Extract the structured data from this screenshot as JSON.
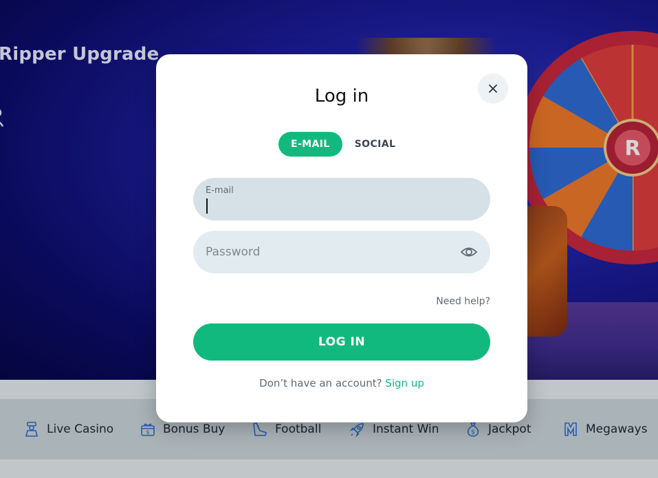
{
  "background": {
    "promo_title": "Ripper Upgrade",
    "nav": [
      {
        "label": "Live Casino",
        "icon": "dealer-icon"
      },
      {
        "label": "Bonus Buy",
        "icon": "gift-dollar-icon"
      },
      {
        "label": "Football",
        "icon": "football-shoe-icon"
      },
      {
        "label": "Instant Win",
        "icon": "rocket-icon"
      },
      {
        "label": "Jackpot",
        "icon": "money-bag-icon"
      },
      {
        "label": "Megaways",
        "icon": "megaways-m-icon"
      }
    ]
  },
  "modal": {
    "title": "Log in",
    "close_icon": "close-icon",
    "tabs": [
      {
        "label": "E-MAIL",
        "active": true
      },
      {
        "label": "SOCIAL",
        "active": false
      }
    ],
    "email_label": "E-mail",
    "email_value": "",
    "password_placeholder": "Password",
    "password_icon": "eye-icon",
    "need_help": "Need help?",
    "login_button": "LOG IN",
    "no_account_text": "Don’t have an account?",
    "signup_link": "Sign up"
  },
  "colors": {
    "accent": "#12b97e",
    "hero_blue": "#1e1ea0",
    "field_bg": "#d6e1e7"
  }
}
